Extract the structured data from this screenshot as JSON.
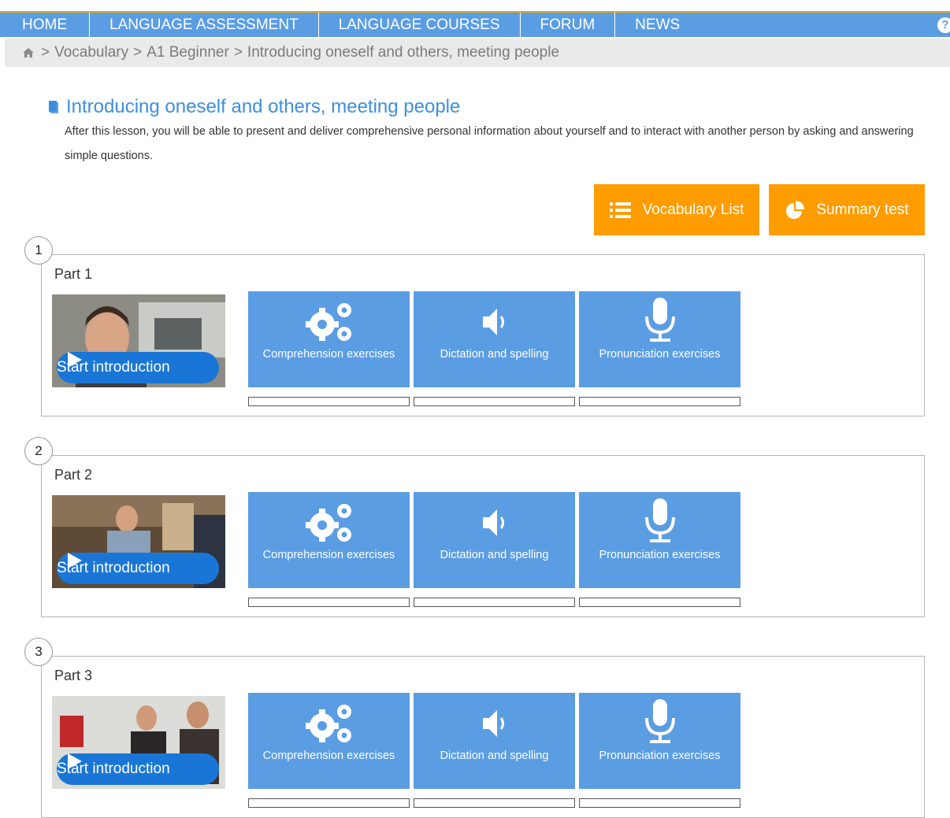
{
  "nav": {
    "items": [
      "HOME",
      "LANGUAGE ASSESSMENT",
      "LANGUAGE COURSES",
      "FORUM",
      "NEWS"
    ],
    "help_label": "?"
  },
  "breadcrumb": [
    ">",
    "Vocabulary",
    ">",
    "A1 Beginner",
    ">",
    "Introducing oneself and others, meeting people"
  ],
  "lesson": {
    "title": "Introducing oneself and others, meeting people",
    "description": "After this lesson, you will be able to present and deliver comprehensive personal information about yourself and to interact with another person by asking and answering simple questions."
  },
  "actions": {
    "vocab_label": "Vocabulary List",
    "summary_label": "Summary test"
  },
  "parts": [
    {
      "number": "1",
      "title": "Part 1",
      "start_label": "Start introduction"
    },
    {
      "number": "2",
      "title": "Part 2",
      "start_label": "Start introduction"
    },
    {
      "number": "3",
      "title": "Part 3",
      "start_label": "Start introduction"
    }
  ],
  "tiles": {
    "comprehension": "Comprehension exercises",
    "dictation": "Dictation and spelling",
    "pronunciation": "Pronunciation exercises"
  },
  "colors": {
    "accent": "#5b9de3",
    "action": "#ff9c00",
    "title": "#3d8fe0"
  }
}
